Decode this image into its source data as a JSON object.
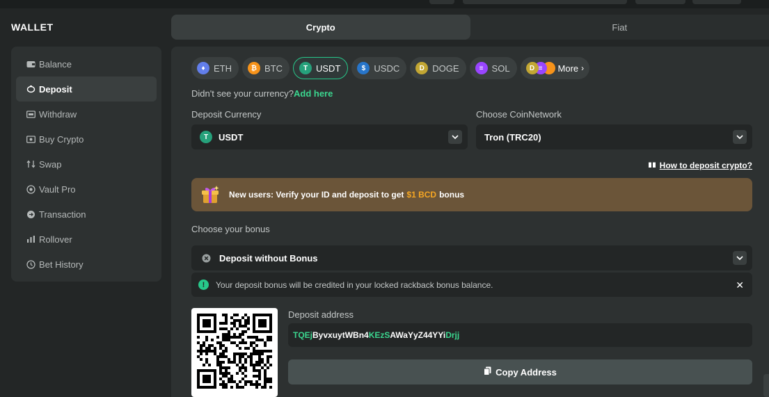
{
  "window": {
    "title": "WALLET"
  },
  "tabs": [
    {
      "label": "Crypto",
      "active": true
    },
    {
      "label": "Fiat",
      "active": false
    }
  ],
  "sidebar": {
    "items": [
      {
        "label": "Balance",
        "icon": "wallet-icon",
        "active": false
      },
      {
        "label": "Deposit",
        "icon": "piggy-bank-icon",
        "active": true
      },
      {
        "label": "Withdraw",
        "icon": "withdraw-icon",
        "active": false
      },
      {
        "label": "Buy Crypto",
        "icon": "card-icon",
        "active": false
      },
      {
        "label": "Swap",
        "icon": "swap-icon",
        "active": false
      },
      {
        "label": "Vault Pro",
        "icon": "vault-icon",
        "active": false
      },
      {
        "label": "Transaction",
        "icon": "transaction-icon",
        "active": false
      },
      {
        "label": "Rollover",
        "icon": "bar-chart-icon",
        "active": false
      },
      {
        "label": "Bet History",
        "icon": "clock-icon",
        "active": false
      }
    ]
  },
  "currencies": [
    {
      "label": "ETH",
      "icon": "ethereum-icon",
      "color": "#627eea",
      "glyph": "♦",
      "active": false
    },
    {
      "label": "BTC",
      "icon": "bitcoin-icon",
      "color": "#f7931a",
      "glyph": "₿",
      "active": false
    },
    {
      "label": "USDT",
      "icon": "tether-icon",
      "color": "#26a17b",
      "glyph": "T",
      "active": true
    },
    {
      "label": "USDC",
      "icon": "usdc-icon",
      "color": "#2775ca",
      "glyph": "$",
      "active": false
    },
    {
      "label": "DOGE",
      "icon": "doge-icon",
      "color": "#c2a633",
      "glyph": "D",
      "active": false
    },
    {
      "label": "SOL",
      "icon": "solana-icon",
      "color": "#9945ff",
      "glyph": "≡",
      "active": false
    }
  ],
  "more": {
    "label": "More"
  },
  "missing": {
    "text": "Didn't see your currency?",
    "link": "Add here"
  },
  "deposit_currency": {
    "label": "Deposit Currency",
    "value": "USDT"
  },
  "network": {
    "label": "Choose CoinNetwork",
    "value": "Tron (TRC20)"
  },
  "howto": {
    "label": "How to deposit crypto?"
  },
  "promo": {
    "before": "New users: Verify your ID and deposit to get",
    "amount": "$1 BCD",
    "after": "bonus"
  },
  "bonus": {
    "label": "Choose your bonus",
    "value": "Deposit without Bonus"
  },
  "notice": {
    "text": "Your deposit bonus will be credited in your locked rackback bonus balance."
  },
  "address": {
    "label": "Deposit address",
    "parts": [
      {
        "text": "TQEj",
        "highlight": true
      },
      {
        "text": "ByvxuytWBn4",
        "highlight": false
      },
      {
        "text": "KEzS",
        "highlight": true
      },
      {
        "text": "AWaYyZ44YYi",
        "highlight": false
      },
      {
        "text": "Drjj",
        "highlight": true
      }
    ]
  },
  "copy": {
    "label": "Copy Address"
  },
  "colors": {
    "accent": "#27c88a",
    "promo": "#f5a623",
    "panel": "#2d3131"
  }
}
